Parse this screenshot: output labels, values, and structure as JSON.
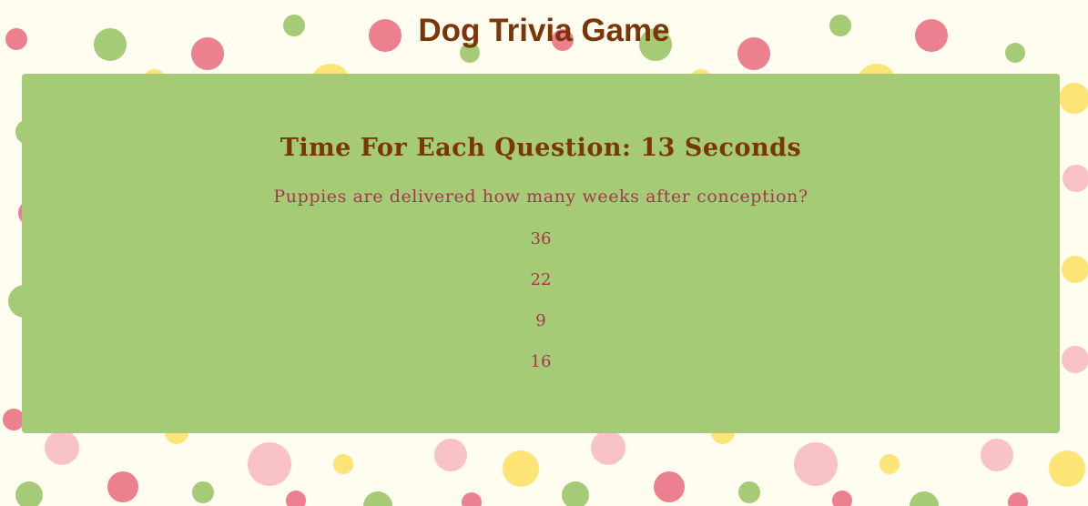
{
  "header": {
    "title": "Dog Trivia Game"
  },
  "game": {
    "timer_text": "Time For Each Question: 13 Seconds",
    "question": "Puppies are delivered how many weeks after conception?",
    "answers": [
      "36",
      "22",
      "9",
      "16"
    ]
  },
  "colors": {
    "background": "#fffcf0",
    "panel": "#a6cb76",
    "title": "#7a3608",
    "text": "#a4394a",
    "dot_green": "#a6cb76",
    "dot_red": "#ec808f",
    "dot_pink": "#f9c3c6",
    "dot_yellow": "#fce477"
  }
}
